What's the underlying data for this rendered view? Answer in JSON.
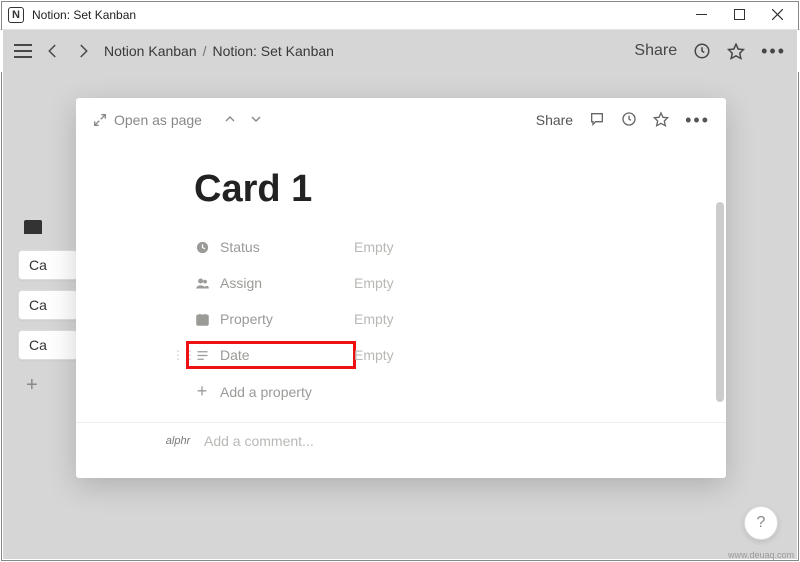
{
  "window": {
    "title": "Notion: Set Kanban"
  },
  "topbar": {
    "breadcrumb": [
      "Notion Kanban",
      "Notion: Set Kanban"
    ],
    "share": "Share"
  },
  "background": {
    "cards": [
      "Ca",
      "Ca",
      "Ca"
    ]
  },
  "modal": {
    "open_as_page": "Open as page",
    "share": "Share",
    "title": "Card 1",
    "properties": [
      {
        "icon": "status",
        "label": "Status",
        "value": "Empty",
        "highlight": false
      },
      {
        "icon": "assign",
        "label": "Assign",
        "value": "Empty",
        "highlight": false
      },
      {
        "icon": "date-cal",
        "label": "Property",
        "value": "Empty",
        "highlight": false
      },
      {
        "icon": "text",
        "label": "Date",
        "value": "Empty",
        "highlight": true
      }
    ],
    "add_property": "Add a property",
    "comment_placeholder": "Add a comment...",
    "avatar": "alphr"
  },
  "help": "?",
  "watermark": "www.deuaq.com"
}
